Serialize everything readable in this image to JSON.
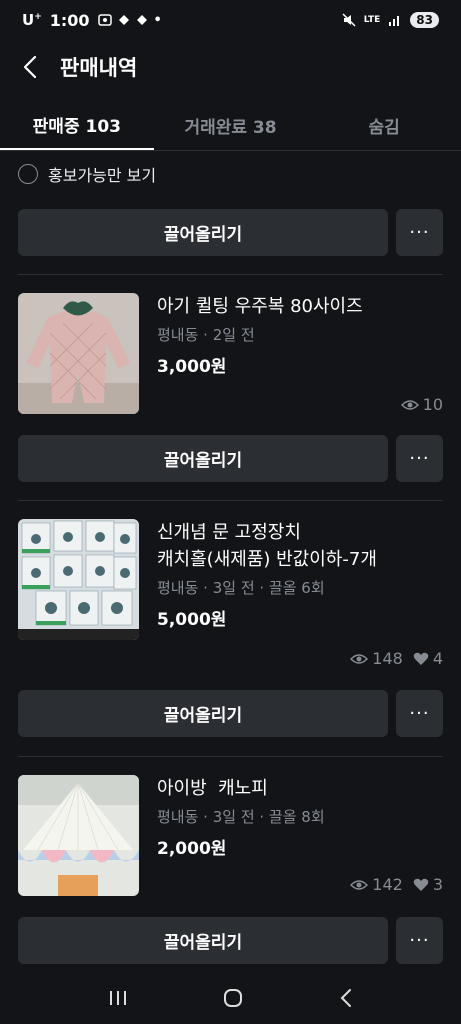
{
  "status_bar": {
    "carrier": "U",
    "carrier_sup": "+",
    "time": "1:00",
    "network": "LTE",
    "battery": "83"
  },
  "header": {
    "title": "판매내역"
  },
  "tabs": [
    {
      "label": "판매중 103"
    },
    {
      "label": "거래완료 38"
    },
    {
      "label": "숨김"
    }
  ],
  "filter": {
    "label": "홍보가능만 보기"
  },
  "actions": {
    "bump_label": "끌어올리기",
    "more_label": "···"
  },
  "items": [
    {
      "title": "아기 퀼팅 우주복 80사이즈",
      "meta": "평내동 · 2일 전",
      "price": "3,000원",
      "views": "10",
      "likes": ""
    },
    {
      "title_line1": "신개념 문 고정장치",
      "title_line2": "캐치홀(새제품) 반값이하-7개",
      "meta": "평내동 · 3일 전 · 끌올 6회",
      "price": "5,000원",
      "views": "148",
      "likes": "4"
    },
    {
      "title": "아이방  캐노피",
      "meta": "평내동 · 3일 전 · 끌올 8회",
      "price": "2,000원",
      "views": "142",
      "likes": "3"
    }
  ],
  "colors": {
    "background": "#121417",
    "button": "#2b2e33",
    "muted": "#868b94"
  }
}
